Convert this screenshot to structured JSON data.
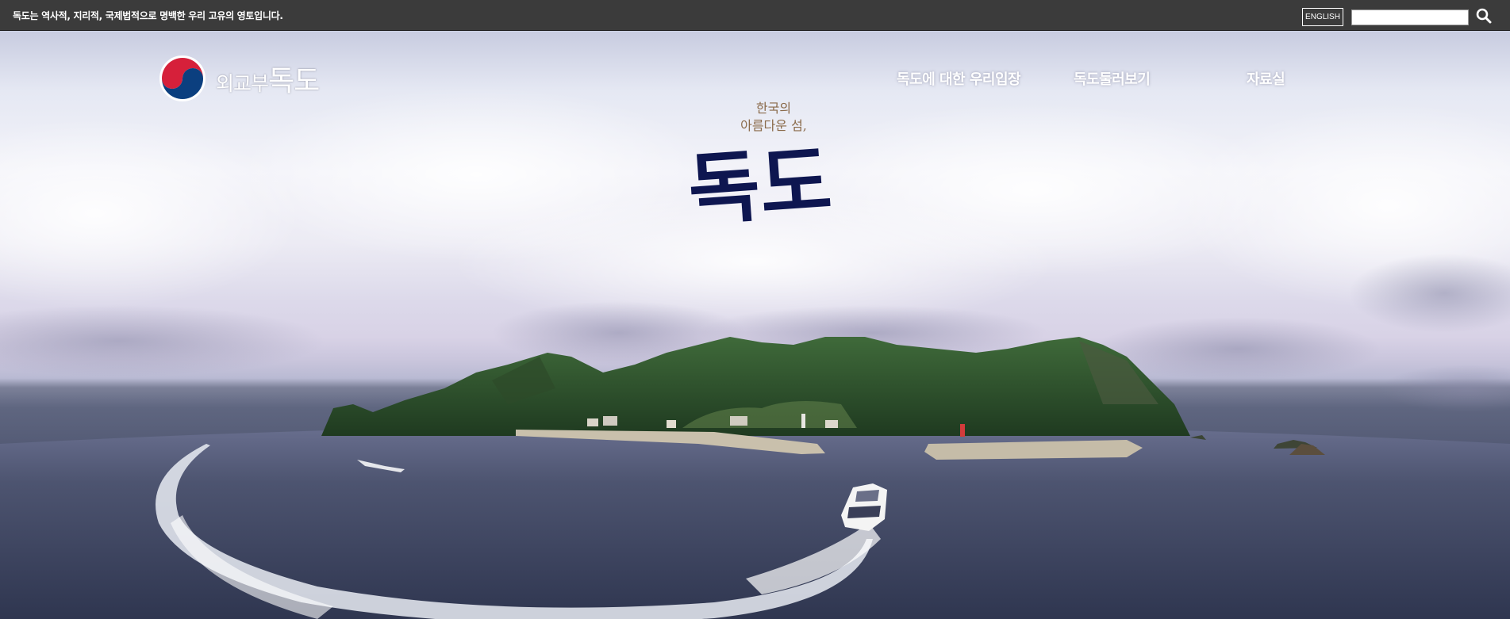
{
  "topbar": {
    "notice": "독도는 역사적, 지리적, 국제법적으로 명백한 우리 고유의 영토입니다.",
    "language_button": "ENGLISH",
    "search_placeholder": "",
    "search_icon": "search-icon"
  },
  "header": {
    "logo_text_small": "외교부",
    "logo_text_big": "독도",
    "logo_icon": "taegeuk-emblem-icon"
  },
  "nav": {
    "items": [
      {
        "label": "독도에 대한 우리입장"
      },
      {
        "label": "독도둘러보기"
      },
      {
        "label": "자료실"
      }
    ]
  },
  "hero": {
    "subtitle_line1": "한국의",
    "subtitle_line2": "아름다운 섬,",
    "title": "독도"
  },
  "colors": {
    "topbar_bg": "#3b3b3b",
    "title_color": "#0e1650",
    "subtitle_color": "#8a6a4a",
    "emblem_red": "#d6203a",
    "emblem_blue": "#0b3f7f"
  }
}
